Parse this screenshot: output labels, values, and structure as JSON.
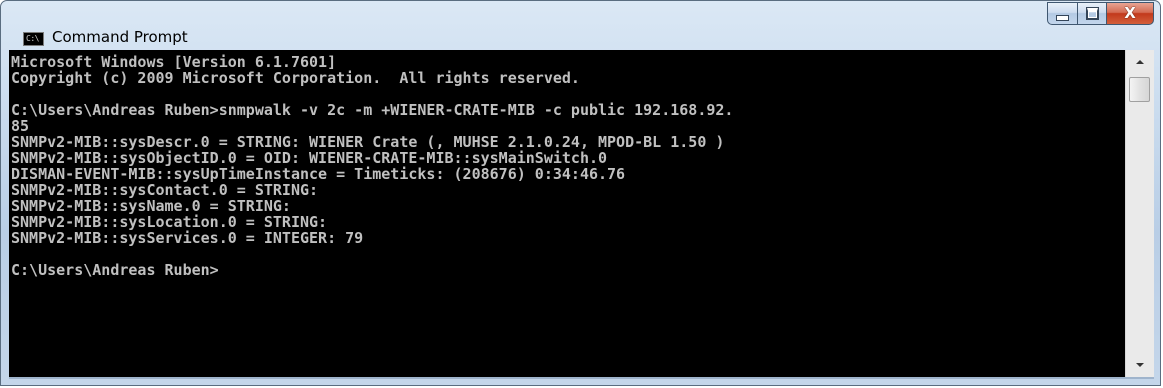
{
  "window": {
    "title": "Command Prompt",
    "icon_label": "C:\\",
    "icon": "console-app-icon",
    "buttons": {
      "minimize": "minimize-icon",
      "maximize": "maximize-icon",
      "close": "close-icon",
      "close_glyph": "X"
    }
  },
  "console": {
    "foreground": "#c0c0c0",
    "background": "#000000",
    "lines": [
      "Microsoft Windows [Version 6.1.7601]",
      "Copyright (c) 2009 Microsoft Corporation.  All rights reserved.",
      "",
      "C:\\Users\\Andreas Ruben>snmpwalk -v 2c -m +WIENER-CRATE-MIB -c public 192.168.92.",
      "85",
      "SNMPv2-MIB::sysDescr.0 = STRING: WIENER Crate (, MUHSE 2.1.0.24, MPOD-BL 1.50 )",
      "SNMPv2-MIB::sysObjectID.0 = OID: WIENER-CRATE-MIB::sysMainSwitch.0",
      "DISMAN-EVENT-MIB::sysUpTimeInstance = Timeticks: (208676) 0:34:46.76",
      "SNMPv2-MIB::sysContact.0 = STRING:",
      "SNMPv2-MIB::sysName.0 = STRING:",
      "SNMPv2-MIB::sysLocation.0 = STRING:",
      "SNMPv2-MIB::sysServices.0 = INTEGER: 79",
      "",
      "C:\\Users\\Andreas Ruben>"
    ]
  },
  "scrollbar": {
    "up_icon": "scroll-up-arrow-icon",
    "down_icon": "scroll-down-arrow-icon"
  }
}
